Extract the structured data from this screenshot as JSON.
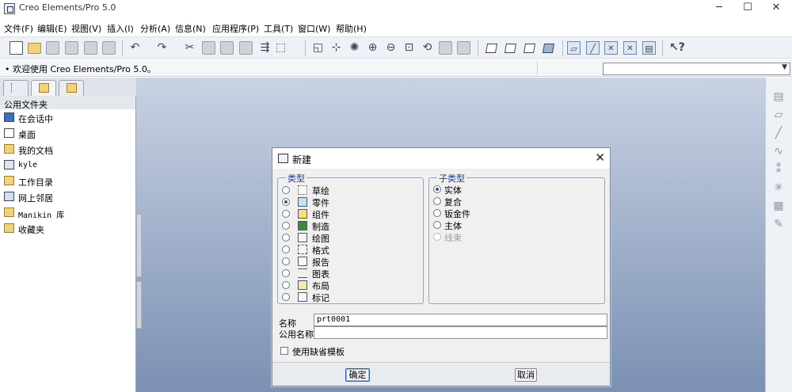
{
  "window": {
    "title": "Creo Elements/Pro 5.0"
  },
  "menu": [
    "文件(F)",
    "编辑(E)",
    "视图(V)",
    "插入(I)",
    "分析(A)",
    "信息(N)",
    "应用程序(P)",
    "工具(T)",
    "窗口(W)",
    "帮助(H)"
  ],
  "message": "欢迎使用 Creo Elements/Pro 5.0。",
  "navigator": {
    "header": "公用文件夹",
    "items": [
      "在会话中",
      "桌面",
      "我的文档",
      "kyle",
      "工作目录",
      "网上邻居",
      "Manikin 库",
      "收藏夹"
    ]
  },
  "dialog": {
    "title": "新建",
    "type_group": "类型",
    "types": [
      "草绘",
      "零件",
      "组件",
      "制造",
      "绘图",
      "格式",
      "报告",
      "图表",
      "布局",
      "标记"
    ],
    "selected_type": "零件",
    "subtype_group": "子类型",
    "subtypes": [
      "实体",
      "复合",
      "钣金件",
      "主体",
      "线束"
    ],
    "selected_subtype": "实体",
    "disabled_subtype": "线束",
    "name_label": "名称",
    "name_value": "prt0001",
    "common_name_label": "公用名称",
    "common_name_value": "",
    "use_template_label": "使用缺省模板",
    "use_template_checked": false,
    "ok_label": "确定",
    "cancel_label": "取消"
  }
}
